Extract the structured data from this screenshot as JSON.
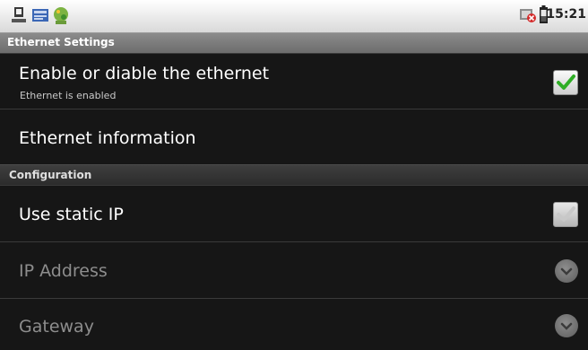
{
  "status_bar": {
    "time": "15:21",
    "icons": [
      "usb-icon",
      "sd-card-icon",
      "android-icon",
      "no-connection-icon",
      "battery-icon"
    ]
  },
  "window": {
    "title": "Ethernet Settings"
  },
  "prefs": {
    "enable": {
      "title": "Enable or diable the ethernet",
      "summary": "Ethernet is enabled",
      "checked": true
    },
    "info": {
      "title": "Ethernet information"
    }
  },
  "configuration": {
    "header": "Configuration",
    "static_ip": {
      "title": "Use static IP",
      "checked": false
    },
    "ip_address": {
      "title": "IP Address",
      "enabled": false
    },
    "gateway": {
      "title": "Gateway",
      "enabled": false
    }
  },
  "colors": {
    "check_accent": "#2fae26",
    "background": "#141414",
    "titlebar": "#7b7b7b"
  }
}
